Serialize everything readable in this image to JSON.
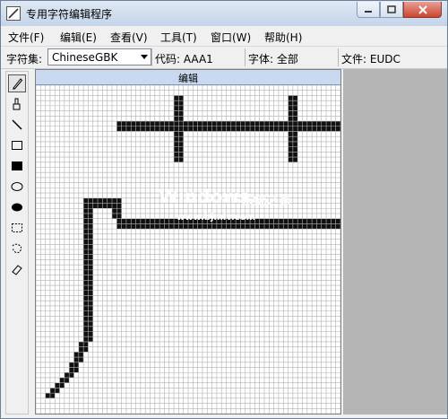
{
  "window": {
    "title": "专用字符编辑程序"
  },
  "menu": [
    {
      "label": "文件(F)"
    },
    {
      "label": "编辑(E)"
    },
    {
      "label": "查看(V)"
    },
    {
      "label": "工具(T)"
    },
    {
      "label": "窗口(W)"
    },
    {
      "label": "帮助(H)"
    }
  ],
  "info_bar": {
    "charset_label": "字符集:",
    "charset_value": "ChineseGBK",
    "code": "代码: AAA1",
    "font": "字体: 全部",
    "file": "文件: EUDC"
  },
  "tools": [
    {
      "icon": "pencil-icon",
      "active": true
    },
    {
      "icon": "brush-icon"
    },
    {
      "icon": "line-icon"
    },
    {
      "icon": "hollow-rectangle-icon"
    },
    {
      "icon": "filled-rectangle-icon"
    },
    {
      "icon": "hollow-ellipse-icon"
    },
    {
      "icon": "filled-ellipse-icon"
    },
    {
      "icon": "rectangular-select-icon"
    },
    {
      "icon": "freeform-select-icon"
    },
    {
      "icon": "eraser-icon"
    }
  ],
  "editor": {
    "title": "编辑",
    "grid_cols": 64,
    "grid_rows": 64,
    "filled_runs": [
      [
        2,
        29,
        30,
        53,
        54
      ],
      [
        3,
        29,
        30,
        53,
        54
      ],
      [
        4,
        29,
        30,
        53,
        54
      ],
      [
        5,
        29,
        30,
        53,
        54
      ],
      [
        6,
        29,
        30,
        53,
        54
      ],
      [
        7,
        17,
        63
      ],
      [
        8,
        17,
        63
      ],
      [
        9,
        29,
        30,
        53,
        54
      ],
      [
        10,
        29,
        30,
        53,
        54
      ],
      [
        11,
        29,
        30,
        53,
        54
      ],
      [
        12,
        29,
        30,
        53,
        54
      ],
      [
        13,
        29,
        30,
        53,
        54
      ],
      [
        14,
        29,
        30,
        53,
        54
      ],
      [
        22,
        10,
        17
      ],
      [
        23,
        10,
        17
      ],
      [
        24,
        10,
        11,
        16,
        17
      ],
      [
        25,
        10,
        11,
        16,
        17
      ],
      [
        26,
        10,
        11,
        17,
        63
      ],
      [
        27,
        10,
        11,
        17,
        63
      ],
      [
        28,
        10,
        11
      ],
      [
        29,
        10,
        11
      ],
      [
        30,
        10,
        11
      ],
      [
        31,
        10,
        11
      ],
      [
        32,
        10,
        11
      ],
      [
        33,
        10,
        11
      ],
      [
        34,
        10,
        11
      ],
      [
        35,
        10,
        11
      ],
      [
        36,
        10,
        11
      ],
      [
        37,
        10,
        11
      ],
      [
        38,
        10,
        11
      ],
      [
        39,
        10,
        11
      ],
      [
        40,
        10,
        11
      ],
      [
        41,
        10,
        11
      ],
      [
        42,
        10,
        11
      ],
      [
        43,
        10,
        11
      ],
      [
        44,
        10,
        11
      ],
      [
        45,
        10,
        11
      ],
      [
        46,
        10,
        11
      ],
      [
        47,
        10,
        11
      ],
      [
        48,
        10,
        11
      ],
      [
        49,
        10,
        11
      ],
      [
        50,
        9,
        10
      ],
      [
        51,
        9,
        10
      ],
      [
        52,
        8,
        9
      ],
      [
        53,
        8,
        9
      ],
      [
        54,
        7,
        8
      ],
      [
        55,
        7,
        8
      ],
      [
        56,
        6,
        7
      ],
      [
        57,
        5,
        6
      ],
      [
        58,
        4,
        5
      ],
      [
        59,
        3,
        4
      ],
      [
        60,
        2,
        3
      ]
    ]
  },
  "watermark": {
    "line1": "Windows",
    "line2": "系统之家",
    "line3": "www.bjmlv.com"
  }
}
